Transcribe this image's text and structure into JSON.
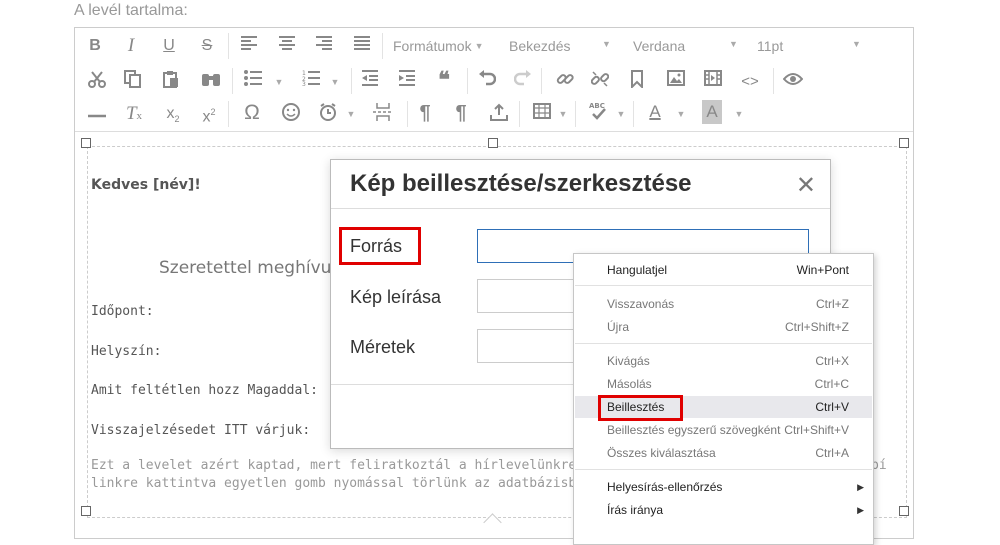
{
  "section_label": "A levél tartalma:",
  "toolbar": {
    "row1": {
      "bold": "B",
      "italic": "I",
      "underline": "U",
      "strike": "S",
      "formats": "Formátumok",
      "block": "Bekezdés",
      "font": "Verdana",
      "size": "11pt"
    },
    "row3": {
      "omega": "Ω",
      "pilcrow1": "¶",
      "pilcrow2": "¶",
      "text_color": "A",
      "bg_color": "A",
      "quote": "❝",
      "code": "<>"
    }
  },
  "content": {
    "greeting": "Kedves [név]!",
    "invite": "Szeretettel meghívu",
    "time": "Időpont:",
    "place": "Helyszín:",
    "bring": "Amit feltétlen hozz Magaddal:",
    "feedback": "Visszajelzésedet ITT várjuk:",
    "footer_line1": "Ezt a levelet azért kaptad, mert feliratkoztál a hírlevelünkre. Ha nem",
    "footer_line1_tail": "bí",
    "footer_line2": "linkre kattintva egyetlen gomb nyomással törlünk az adatbázisból: ["
  },
  "dialog": {
    "title": "Kép beillesztése/szerkesztése",
    "close": "✕",
    "source_label": "Forrás",
    "source_value": "",
    "description_label": "Kép leírása",
    "dimensions_label": "Méretek"
  },
  "context_menu": {
    "items": [
      {
        "label": "Hangulatjel",
        "shortcut": "Win+Pont",
        "disabled": false
      },
      {
        "label": "Visszavonás",
        "shortcut": "Ctrl+Z",
        "disabled": true
      },
      {
        "label": "Újra",
        "shortcut": "Ctrl+Shift+Z",
        "disabled": true
      },
      {
        "label": "Kivágás",
        "shortcut": "Ctrl+X",
        "disabled": true
      },
      {
        "label": "Másolás",
        "shortcut": "Ctrl+C",
        "disabled": true
      },
      {
        "label": "Beillesztés",
        "shortcut": "Ctrl+V",
        "disabled": false
      },
      {
        "label": "Beillesztés egyszerű szövegként",
        "shortcut": "Ctrl+Shift+V",
        "disabled": true
      },
      {
        "label": "Összes kiválasztása",
        "shortcut": "Ctrl+A",
        "disabled": true
      },
      {
        "label": "Helyesírás-ellenőrzés",
        "shortcut": "",
        "disabled": false
      },
      {
        "label": "Írás iránya",
        "shortcut": "",
        "disabled": false
      }
    ]
  },
  "colors": {
    "highlight_red": "#e00000",
    "focus_blue": "#2e6fb7"
  }
}
